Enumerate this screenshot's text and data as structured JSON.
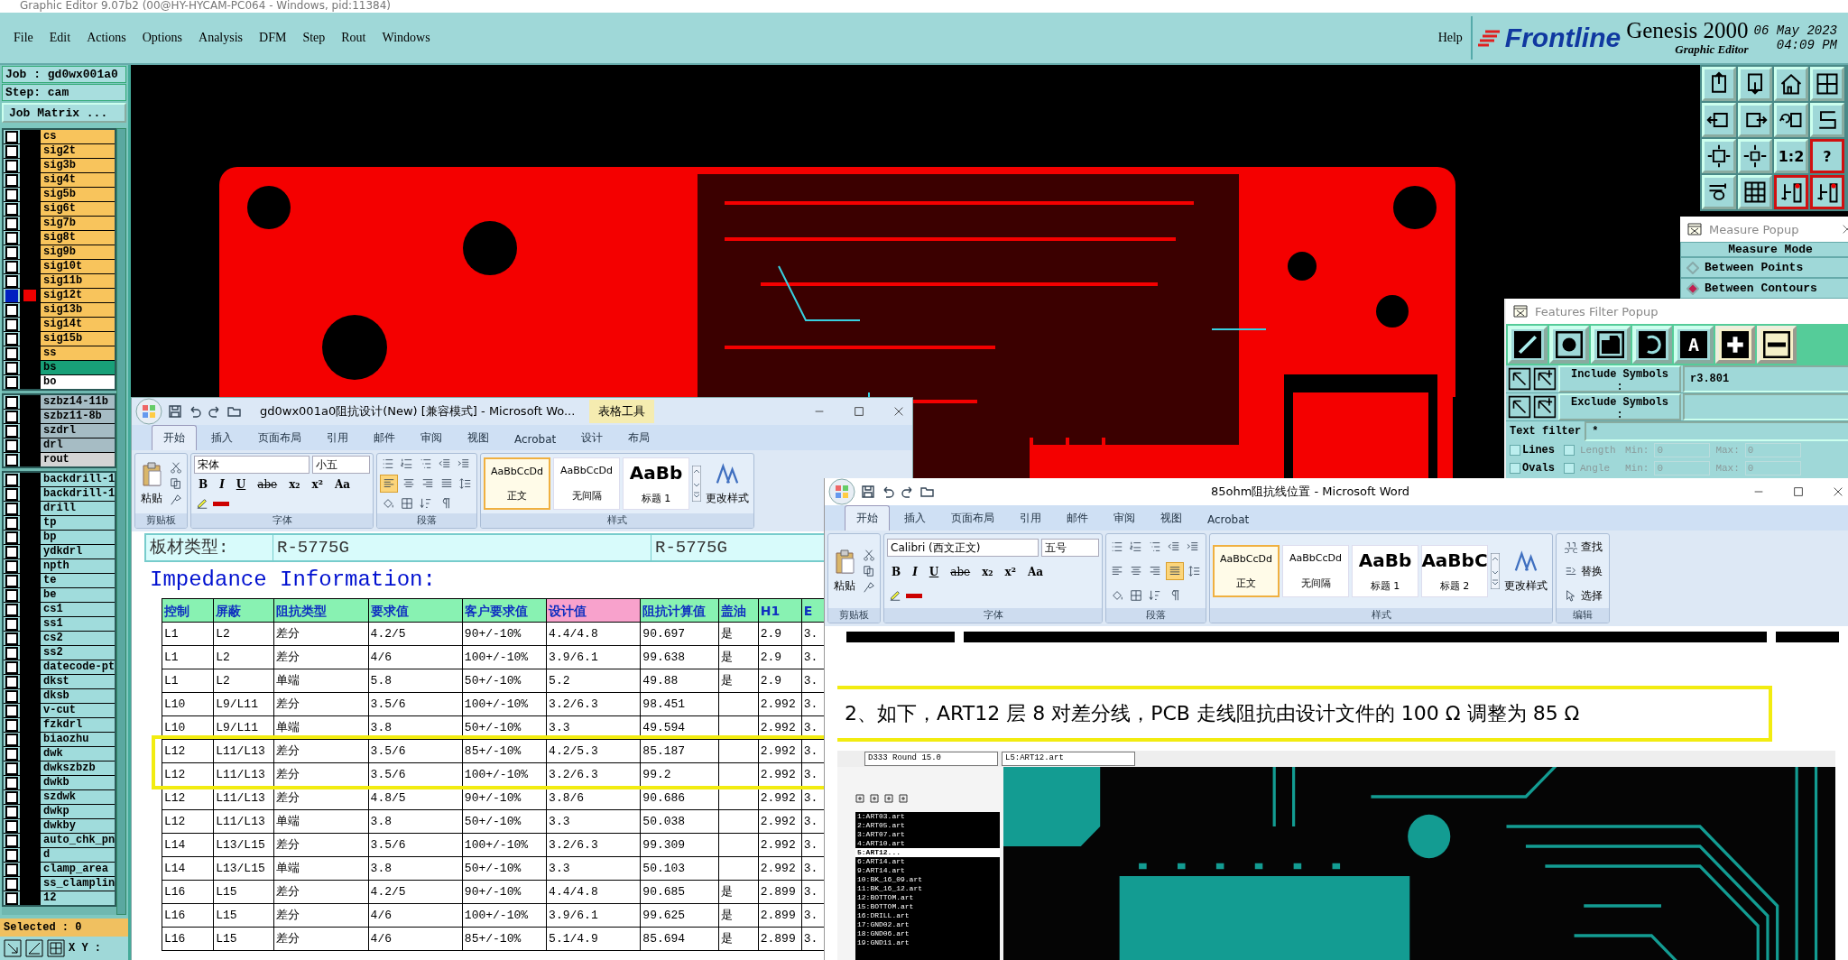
{
  "app": {
    "title": "Graphic Editor 9.07b2 (00@HY-HYCAM-PC064 - Windows, pid:11384)",
    "menu": [
      "File",
      "Edit",
      "Actions",
      "Options",
      "Analysis",
      "DFM",
      "Step",
      "Rout",
      "Windows"
    ],
    "help": "Help",
    "logo": {
      "brand": "Frontline",
      "product": "Genesis 2000",
      "subtitle": "Graphic Editor"
    },
    "date": "06 May 2023",
    "time": "04:09 PM"
  },
  "side_panel": {
    "job": "Job : gd0wx001a0",
    "step": "Step: cam",
    "matrix_button": "Job Matrix ...",
    "layer_groups": [
      {
        "layers": [
          {
            "name": "cs",
            "color": "#f8c45c",
            "selected": false
          },
          {
            "name": "sig2t",
            "color": "#f8c45c",
            "selected": false
          },
          {
            "name": "sig3b",
            "color": "#f8c45c",
            "selected": false
          },
          {
            "name": "sig4t",
            "color": "#f8c45c",
            "selected": false
          },
          {
            "name": "sig5b",
            "color": "#f8c45c",
            "selected": false
          },
          {
            "name": "sig6t",
            "color": "#f8c45c",
            "selected": false
          },
          {
            "name": "sig7b",
            "color": "#f8c45c",
            "selected": false
          },
          {
            "name": "sig8t",
            "color": "#f8c45c",
            "selected": false
          },
          {
            "name": "sig9b",
            "color": "#f8c45c",
            "selected": false
          },
          {
            "name": "sig10t",
            "color": "#f8c45c",
            "selected": false
          },
          {
            "name": "sig11b",
            "color": "#f8c45c",
            "selected": false
          },
          {
            "name": "sig12t",
            "color": "#f8c45c",
            "selected": true
          },
          {
            "name": "sig13b",
            "color": "#f8c45c",
            "selected": false
          },
          {
            "name": "sig14t",
            "color": "#f8c45c",
            "selected": false
          },
          {
            "name": "sig15b",
            "color": "#f8c45c",
            "selected": false
          },
          {
            "name": "ss",
            "color": "#f8c45c",
            "selected": false
          },
          {
            "name": "bs",
            "color": "#18a078",
            "selected": false
          },
          {
            "name": "bo",
            "color": "#ffffff",
            "selected": false
          }
        ]
      },
      {
        "layers": [
          {
            "name": "szbz14-11b",
            "color": "#a6bcc4",
            "selected": false
          },
          {
            "name": "szbz11-8b",
            "color": "#a6bcc4",
            "selected": false
          },
          {
            "name": "szdrl",
            "color": "#a6bcc4",
            "selected": false
          },
          {
            "name": "drl",
            "color": "#a6bcc4",
            "selected": false
          },
          {
            "name": "rout",
            "color": "#d4d4d4",
            "selected": false
          }
        ]
      },
      {
        "layers": [
          {
            "name": "backdrill-1",
            "color": "#a0dcdc",
            "selected": false
          },
          {
            "name": "backdrill-1",
            "color": "#a0dcdc",
            "selected": false
          },
          {
            "name": "drill",
            "color": "#a0dcdc",
            "selected": false
          },
          {
            "name": "tp",
            "color": "#a0dcdc",
            "selected": false
          },
          {
            "name": "bp",
            "color": "#a0dcdc",
            "selected": false
          },
          {
            "name": "ydkdrl",
            "color": "#a0dcdc",
            "selected": false
          },
          {
            "name": "npth",
            "color": "#a0dcdc",
            "selected": false
          },
          {
            "name": "te",
            "color": "#a0dcdc",
            "selected": false
          },
          {
            "name": "be",
            "color": "#a0dcdc",
            "selected": false
          },
          {
            "name": "cs1",
            "color": "#a0dcdc",
            "selected": false
          },
          {
            "name": "ss1",
            "color": "#a0dcdc",
            "selected": false
          },
          {
            "name": "cs2",
            "color": "#a0dcdc",
            "selected": false
          },
          {
            "name": "ss2",
            "color": "#a0dcdc",
            "selected": false
          },
          {
            "name": "datecode-pt",
            "color": "#a0dcdc",
            "selected": false
          },
          {
            "name": "dkst",
            "color": "#a0dcdc",
            "selected": false
          },
          {
            "name": "dksb",
            "color": "#a0dcdc",
            "selected": false
          },
          {
            "name": "v-cut",
            "color": "#a0dcdc",
            "selected": false
          },
          {
            "name": "fzkdrl",
            "color": "#a0dcdc",
            "selected": false
          },
          {
            "name": "biaozhu",
            "color": "#a0dcdc",
            "selected": false
          },
          {
            "name": "dwk",
            "color": "#a0dcdc",
            "selected": false
          },
          {
            "name": "dwkszbzb",
            "color": "#a0dcdc",
            "selected": false
          },
          {
            "name": "dwkb",
            "color": "#a0dcdc",
            "selected": false
          },
          {
            "name": "szdwk",
            "color": "#a0dcdc",
            "selected": false
          },
          {
            "name": "dwkp",
            "color": "#a0dcdc",
            "selected": false
          },
          {
            "name": "dwkby",
            "color": "#a0dcdc",
            "selected": false
          },
          {
            "name": "auto_chk_pn",
            "color": "#a0dcdc",
            "selected": false
          },
          {
            "name": "d",
            "color": "#a0dcdc",
            "selected": false
          },
          {
            "name": "clamp_area",
            "color": "#a0dcdc",
            "selected": false
          },
          {
            "name": "ss_clamplin",
            "color": "#a0dcdc",
            "selected": false
          },
          {
            "name": "12",
            "color": "#a0dcdc",
            "selected": false
          }
        ]
      }
    ],
    "selected": "Selected : 0",
    "xy": "X Y :"
  },
  "tool_buttons": [
    {
      "kind": "upload"
    },
    {
      "kind": "download"
    },
    {
      "kind": "home"
    },
    {
      "kind": "grid-xy"
    },
    {
      "kind": "left-in"
    },
    {
      "kind": "right-out"
    },
    {
      "kind": "undo"
    },
    {
      "kind": "snake"
    },
    {
      "kind": "fit"
    },
    {
      "kind": "pan"
    },
    {
      "kind": "text",
      "label": "1:2"
    },
    {
      "kind": "help",
      "label": "?"
    },
    {
      "kind": "tools"
    },
    {
      "kind": "grid"
    },
    {
      "kind": "netlist"
    },
    {
      "kind": "netlist"
    }
  ],
  "measure_popup": {
    "title": "Measure Popup",
    "mode_label": "Measure Mode",
    "modes": [
      {
        "label": "Between Points",
        "selected": false
      },
      {
        "label": "Between Contours",
        "selected": true
      }
    ]
  },
  "filter_popup": {
    "title": "Features Filter Popup",
    "shapes": [
      {
        "kind": "line"
      },
      {
        "kind": "pad"
      },
      {
        "kind": "surface"
      },
      {
        "kind": "arc"
      },
      {
        "kind": "text",
        "label": "A"
      },
      {
        "kind": "plus"
      },
      {
        "kind": "minus"
      }
    ],
    "include_label": "Include Symbols :",
    "include_value": "r3.801",
    "exclude_label": "Exclude Symbols :",
    "text_filter_label": "Text filter",
    "text_filter_value": "*",
    "rows": [
      {
        "type": "Lines",
        "checked": false,
        "param": "Length",
        "param_checked": false,
        "param_disabled": true,
        "min_label": "Min:",
        "min": "0",
        "max_label": "Max:",
        "max": "0"
      },
      {
        "type": "Ovals",
        "checked": false,
        "param": "Angle",
        "param_checked": false,
        "param_disabled": true,
        "min_label": "Min:",
        "min": "0",
        "max_label": "Max:",
        "max": "0"
      }
    ]
  },
  "word_windows": [
    {
      "title": "gd0wx001a0阻抗设计(New) [兼容模式] - Microsoft Wo...",
      "context_tab": "表格工具",
      "tabs": [
        {
          "label": "开始",
          "selected": true
        },
        {
          "label": "插入",
          "selected": false
        },
        {
          "label": "页面布局",
          "selected": false
        },
        {
          "label": "引用",
          "selected": false
        },
        {
          "label": "邮件",
          "selected": false
        },
        {
          "label": "审阅",
          "selected": false
        },
        {
          "label": "视图",
          "selected": false
        },
        {
          "label": "Acrobat",
          "selected": false
        },
        {
          "label": "设计",
          "selected": false
        },
        {
          "label": "布局",
          "selected": false
        }
      ],
      "paste": "粘贴",
      "clipboard_group": "剪贴板",
      "font_face": "宋体",
      "font_size": "小五",
      "font_group": "字体",
      "format_buttons": [
        "B",
        "I",
        "U",
        "abe",
        "x₂",
        "x²",
        "Aa"
      ],
      "paragraph_group": "段落",
      "align_buttons": [
        {
          "kind": "left",
          "selected": true
        },
        {
          "kind": "center",
          "selected": false
        },
        {
          "kind": "right",
          "selected": false
        },
        {
          "kind": "justify",
          "selected": false
        }
      ],
      "styles": [
        {
          "sample": "AaBbCcDd",
          "name": "正文",
          "selected": true
        },
        {
          "sample": "AaBbCcDd",
          "name": "无间隔",
          "selected": false
        },
        {
          "sample": "AaBb",
          "name": "标题 1",
          "selected": false
        }
      ],
      "change_styles": "更改样式",
      "styles_group": "样式",
      "document": {
        "kind": "table",
        "material_label": "板材类型:",
        "material_values": [
          "R-5775G",
          "R-5775G"
        ],
        "heading": "Impedance Information:",
        "columns": [
          {
            "label": "控制",
            "color": "#88f2b2"
          },
          {
            "label": "屏蔽",
            "color": "#88f2b2"
          },
          {
            "label": "阻抗类型",
            "color": "#88f2b2"
          },
          {
            "label": "要求值",
            "color": "#88f2b2"
          },
          {
            "label": "客户要求值",
            "color": "#88f2b2"
          },
          {
            "label": "设计值",
            "color": "#f8a2cc"
          },
          {
            "label": "阻抗计算值",
            "color": "#88f2b2"
          },
          {
            "label": "盖油",
            "color": "#88f2b2"
          },
          {
            "label": "H1",
            "color": "#88f2b2"
          },
          {
            "label": "E",
            "color": "#88f2b2"
          }
        ],
        "rows": [
          [
            "L1",
            "L2",
            "差分",
            "4.2/5",
            "90+/-10%",
            "4.4/4.8",
            "90.697",
            "是",
            "2.9",
            "3."
          ],
          [
            "L1",
            "L2",
            "差分",
            "4/6",
            "100+/-10%",
            "3.9/6.1",
            "99.638",
            "是",
            "2.9",
            "3."
          ],
          [
            "L1",
            "L2",
            "单端",
            "5.8",
            "50+/-10%",
            "5.2",
            "49.88",
            "是",
            "2.9",
            "3."
          ],
          [
            "L10",
            "L9/L11",
            "差分",
            "3.5/6",
            "100+/-10%",
            "3.2/6.3",
            "98.451",
            null,
            "2.992",
            "3."
          ],
          [
            "L10",
            "L9/L11",
            "单端",
            "3.8",
            "50+/-10%",
            "3.3",
            "49.594",
            null,
            "2.992",
            "3."
          ],
          [
            "L12",
            "L11/L13",
            "差分",
            "3.5/6",
            "85+/-10%",
            "4.2/5.3",
            "85.187",
            null,
            "2.992",
            "3."
          ],
          [
            "L12",
            "L11/L13",
            "差分",
            "3.5/6",
            "100+/-10%",
            "3.2/6.3",
            "99.2",
            null,
            "2.992",
            "3."
          ],
          [
            "L12",
            "L11/L13",
            "差分",
            "4.8/5",
            "90+/-10%",
            "3.8/6",
            "90.686",
            null,
            "2.992",
            "3."
          ],
          [
            "L12",
            "L11/L13",
            "单端",
            "3.8",
            "50+/-10%",
            "3.3",
            "50.038",
            null,
            "2.992",
            "3."
          ],
          [
            "L14",
            "L13/L15",
            "差分",
            "3.5/6",
            "100+/-10%",
            "3.2/6.3",
            "99.309",
            null,
            "2.992",
            "3."
          ],
          [
            "L14",
            "L13/L15",
            "单端",
            "3.8",
            "50+/-10%",
            "3.3",
            "50.103",
            null,
            "2.992",
            "3."
          ],
          [
            "L16",
            "L15",
            "差分",
            "4.2/5",
            "90+/-10%",
            "4.4/4.8",
            "90.685",
            "是",
            "2.899",
            "3."
          ],
          [
            "L16",
            "L15",
            "差分",
            "4/6",
            "100+/-10%",
            "3.9/6.1",
            "99.625",
            "是",
            "2.899",
            "3."
          ],
          [
            "L16",
            "L15",
            "差分",
            "4/6",
            "85+/-10%",
            "5.1/4.9",
            "85.694",
            "是",
            "2.899",
            "3."
          ]
        ]
      }
    },
    {
      "title": "85ohm阻抗线位置 - Microsoft Word",
      "tabs": [
        {
          "label": "开始",
          "selected": true
        },
        {
          "label": "插入",
          "selected": false
        },
        {
          "label": "页面布局",
          "selected": false
        },
        {
          "label": "引用",
          "selected": false
        },
        {
          "label": "邮件",
          "selected": false
        },
        {
          "label": "审阅",
          "selected": false
        },
        {
          "label": "视图",
          "selected": false
        },
        {
          "label": "Acrobat",
          "selected": false
        }
      ],
      "paste": "粘贴",
      "clipboard_group": "剪贴板",
      "font_face": "Calibri (西文正文)",
      "font_size": "五号",
      "font_group": "字体",
      "format_buttons": [
        "B",
        "I",
        "U",
        "abe",
        "x₂",
        "x²",
        "Aa"
      ],
      "paragraph_group": "段落",
      "align_buttons": [
        {
          "kind": "left",
          "selected": false
        },
        {
          "kind": "center",
          "selected": false
        },
        {
          "kind": "right",
          "selected": false
        },
        {
          "kind": "justify",
          "selected": true
        }
      ],
      "styles": [
        {
          "sample": "AaBbCcDd",
          "name": "正文",
          "selected": true
        },
        {
          "sample": "AaBbCcDd",
          "name": "无间隔",
          "selected": false
        },
        {
          "sample": "AaBb",
          "name": "标题 1",
          "selected": false
        },
        {
          "sample": "AaBbC",
          "name": "标题 2",
          "selected": false
        }
      ],
      "change_styles": "更改样式",
      "styles_group": "样式",
      "editing": [
        "查找",
        "替换",
        "选择"
      ],
      "editing_group": "编辑",
      "document": {
        "kind": "note",
        "text": "2、如下，ART12 层 8 对差分线，PCB 走线阻抗由设计文件的 100 Ω 调整为 85 Ω",
        "screenshot": {
          "dropdowns": [
            "D333  Round 15.0",
            "L5:ART12.art"
          ],
          "layers": [
            {
              "name": "1:ART03.art",
              "selected": false
            },
            {
              "name": "2:ART05.art",
              "selected": false
            },
            {
              "name": "3:ART07.art",
              "selected": false
            },
            {
              "name": "4:ART10.art",
              "selected": false
            },
            {
              "name": "5:ART12...",
              "selected": true
            },
            {
              "name": "6:ART14.art",
              "selected": false
            },
            {
              "name": "9:ART14.art",
              "selected": false
            },
            {
              "name": "10:BK_16_09.art",
              "selected": false
            },
            {
              "name": "11:BK_16_12.art",
              "selected": false
            },
            {
              "name": "12:BOTTOM.art",
              "selected": false
            },
            {
              "name": "15:BOTTOM.art",
              "selected": false
            },
            {
              "name": "16:DRILL.art",
              "selected": false
            },
            {
              "name": "17:GND02.art",
              "selected": false
            },
            {
              "name": "18:GND06.art",
              "selected": false
            },
            {
              "name": "19:GND11.art",
              "selected": false
            }
          ]
        }
      }
    }
  ]
}
